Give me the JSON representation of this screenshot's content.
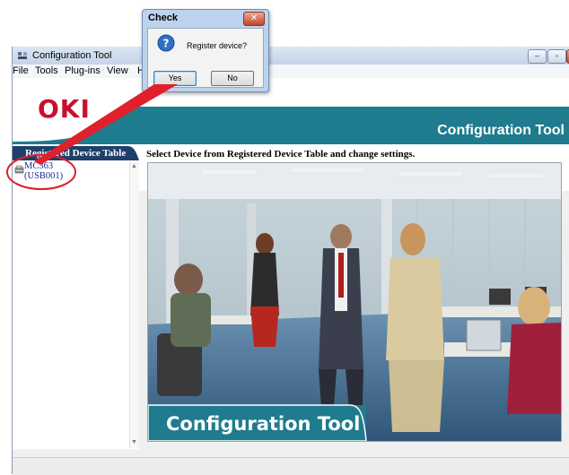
{
  "window": {
    "title": "Configuration Tool",
    "minimize_glyph": "–",
    "maximize_glyph": "▫",
    "close_glyph": "✕"
  },
  "menu": {
    "items": [
      "File",
      "Tools",
      "Plug-ins",
      "View",
      "H"
    ]
  },
  "banner": {
    "logo": "OKI",
    "title": "Configuration Tool"
  },
  "left_panel": {
    "tab_label": "Registered Device Table",
    "device": {
      "name": "MC363",
      "port": "(USB001)"
    }
  },
  "content": {
    "heading": "Select Device from Registered Device Table and change settings.",
    "image_caption": "Configuration Tool"
  },
  "dialog": {
    "title": "Check",
    "message": "Register device?",
    "yes_label": "Yes",
    "no_label": "No",
    "close_glyph": "✕"
  },
  "colors": {
    "banner_teal": "#1f7b8e",
    "logo_red": "#c8102e",
    "annotation_red": "#e0202a",
    "tab_navy": "#1f3f6b"
  }
}
